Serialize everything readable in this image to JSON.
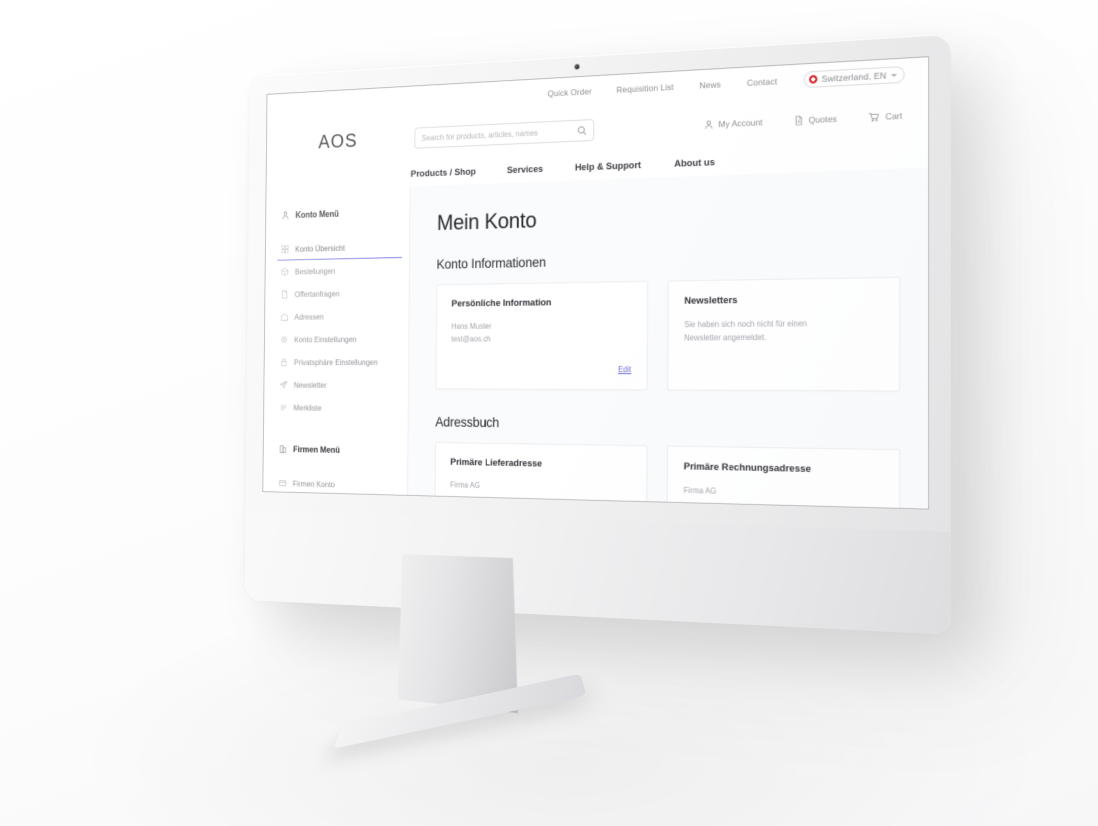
{
  "site": {
    "logo": "AOS"
  },
  "utility_nav": {
    "items": [
      {
        "label": "Quick Order",
        "name": "quick-order"
      },
      {
        "label": "Requisition List",
        "name": "requisition-list"
      },
      {
        "label": "News",
        "name": "news"
      },
      {
        "label": "Contact",
        "name": "contact"
      }
    ],
    "locale": {
      "label": "Switzerland, EN",
      "flag_icon": "swiss-flag-icon",
      "chevron_icon": "chevron-down-icon"
    }
  },
  "search": {
    "placeholder": "Search for products, articles, names",
    "value": "",
    "icon": "search-icon"
  },
  "account_nav": {
    "items": [
      {
        "label": "My Account",
        "icon": "user-icon",
        "name": "my-account"
      },
      {
        "label": "Quotes",
        "icon": "document-icon",
        "name": "quotes"
      },
      {
        "label": "Cart",
        "icon": "cart-icon",
        "name": "cart"
      }
    ]
  },
  "main_nav": {
    "items": [
      {
        "label": "Products / Shop",
        "name": "products-shop"
      },
      {
        "label": "Services",
        "name": "services"
      },
      {
        "label": "Help & Support",
        "name": "help-support"
      },
      {
        "label": "About us",
        "name": "about-us"
      }
    ]
  },
  "sidebar": {
    "groups": [
      {
        "title": "Konto Menü",
        "icon": "user-icon",
        "items": [
          {
            "label": "Konto Übersicht",
            "icon": "grid-icon",
            "active": true
          },
          {
            "label": "Bestellungen",
            "icon": "box-icon",
            "active": false
          },
          {
            "label": "Offertanfragen",
            "icon": "document-icon",
            "active": false
          },
          {
            "label": "Adressen",
            "icon": "home-icon",
            "active": false
          },
          {
            "label": "Konto Einstellungen",
            "icon": "gear-icon",
            "active": false
          },
          {
            "label": "Privatsphäre Einstellungen",
            "icon": "lock-icon",
            "active": false
          },
          {
            "label": "Newsletter",
            "icon": "send-icon",
            "active": false
          },
          {
            "label": "Merkliste",
            "icon": "list-icon",
            "active": false
          }
        ]
      },
      {
        "title": "Firmen Menü",
        "icon": "building-icon",
        "items": [
          {
            "label": "Firmen Konto",
            "icon": "card-icon",
            "active": false
          }
        ]
      }
    ]
  },
  "main": {
    "page_title": "Mein Konto",
    "sections": [
      {
        "title": "Konto Informationen",
        "cards": [
          {
            "title": "Persönliche Information",
            "lines": [
              "Hans Muster",
              "test@aos.ch"
            ],
            "action": "Edit"
          },
          {
            "title": "Newsletters",
            "lines": [
              "Sie haben sich noch nicht für einen",
              "Newsletter angemeldet."
            ],
            "action": ""
          }
        ]
      },
      {
        "title": "Adressbuch",
        "cards": [
          {
            "title": "Primäre Lieferadresse",
            "lines": [
              "Firma AG"
            ],
            "action": ""
          },
          {
            "title": "Primäre Rechnungsadresse",
            "lines": [
              "Firma AG"
            ],
            "action": ""
          }
        ]
      }
    ]
  },
  "colors": {
    "accent": "#7b7be0",
    "link": "#6f6fd8",
    "flag_red": "#d8232a",
    "text_dark": "#24242a",
    "text_muted": "#a3a3aa"
  }
}
